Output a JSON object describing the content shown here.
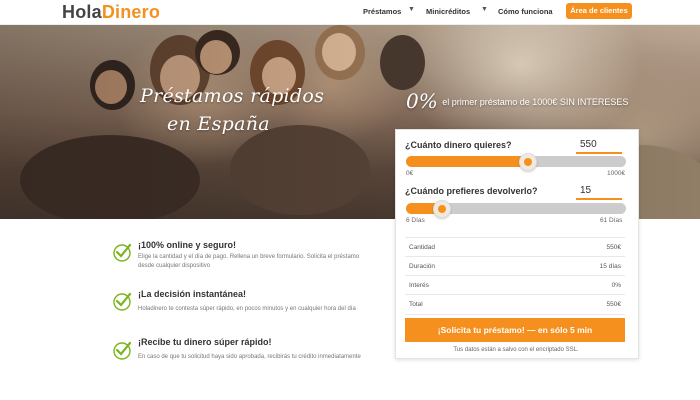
{
  "header": {
    "logo_part1": "Hola",
    "logo_part2": "Dinero",
    "nav": {
      "prestamos": "Préstamos",
      "minicreditos": "Minicréditos",
      "como_funciona": "Cómo funciona"
    },
    "caret_glyph": "▼",
    "cta_label": "Área de clientes"
  },
  "hero": {
    "title_line1": "Préstamos rápidos",
    "title_line2": "en España",
    "promo_big": "0%",
    "promo_text": "el primer préstamo de 1000€ SIN INTERESES"
  },
  "calculator": {
    "amount_question": "¿Cuánto dinero quieres?",
    "amount_value": "550",
    "amount_min_label": "0€",
    "amount_max_label": "1000€",
    "amount_fraction": 0.55,
    "days_question": "¿Cuándo prefieres devolverlo?",
    "days_value": "15",
    "days_min_label": "6 Días",
    "days_max_label": "61 Días",
    "days_fraction": 0.16,
    "summary": [
      {
        "label": "Cantidad",
        "value": "550€"
      },
      {
        "label": "Duración",
        "value": "15 días"
      },
      {
        "label": "Interés",
        "value": "0%"
      },
      {
        "label": "Total",
        "value": "550€"
      }
    ],
    "submit_label": "¡Solicita tu préstamo! — en sólo 5 min",
    "ssl_note": "Tus datos están a salvo con el encriptado SSL."
  },
  "features": [
    {
      "title": "¡100% online y seguro!",
      "text": "Elige la cantidad y el día de pago. Rellena un breve formulario. Solicita el préstamo desde cualquier dispositivo"
    },
    {
      "title": "¡La decisión instantánea!",
      "text": "Holadinero te contesta súper rápido, en pocos minutos y en cualquier hora del día"
    },
    {
      "title": "¡Recibe tu dinero súper rápido!",
      "text": "En caso de que tu solicitud haya sido aprobada, recibirás tu crédito inmediatamente"
    }
  ],
  "colors": {
    "accent": "#f5901e",
    "check": "#7ab51d"
  }
}
